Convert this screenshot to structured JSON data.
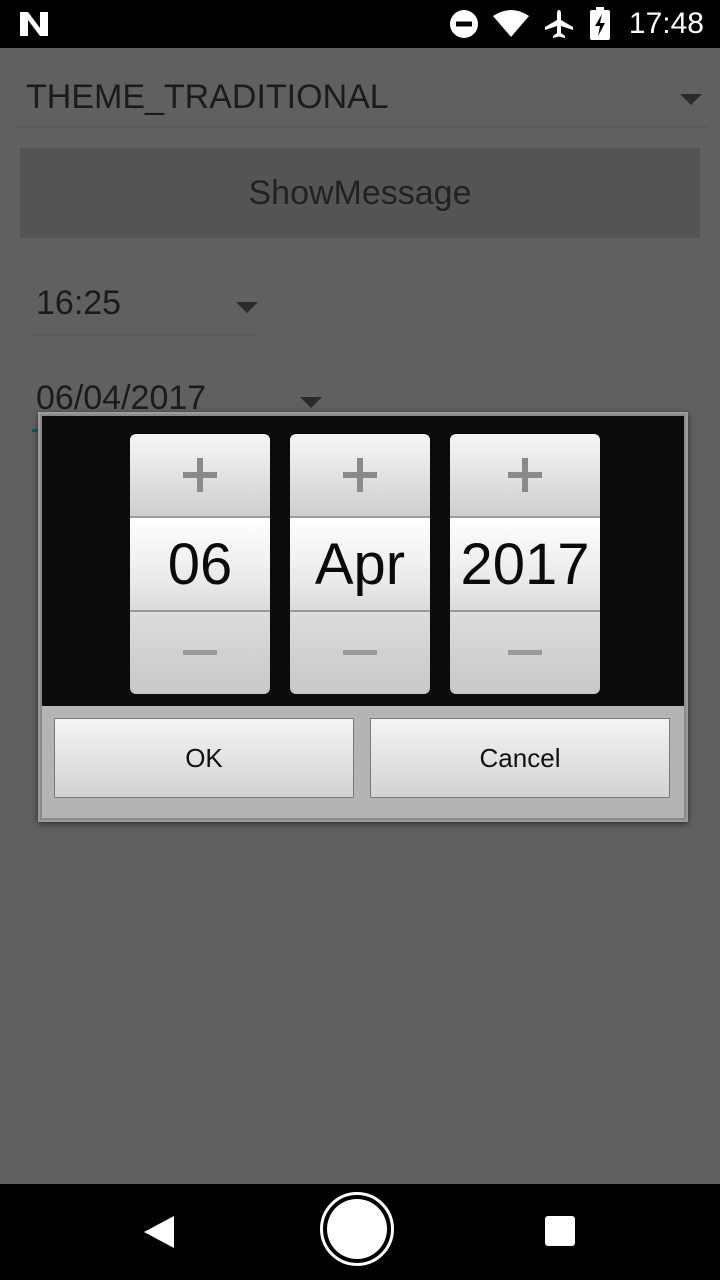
{
  "status_bar": {
    "time": "17:48",
    "icons": [
      "notification-n-icon",
      "do-not-disturb-icon",
      "wifi-icon",
      "airplane-mode-icon",
      "battery-charging-icon"
    ]
  },
  "app": {
    "theme_spinner_value": "THEME_TRADITIONAL",
    "show_message_label": "ShowMessage",
    "time_value": "16:25",
    "date_value": "06/04/2017"
  },
  "date_dialog": {
    "day": "06",
    "month": "Apr",
    "year": "2017",
    "ok_label": "OK",
    "cancel_label": "Cancel"
  },
  "nav_bar": {
    "icons": [
      "back-icon",
      "home-icon",
      "recents-icon"
    ]
  }
}
